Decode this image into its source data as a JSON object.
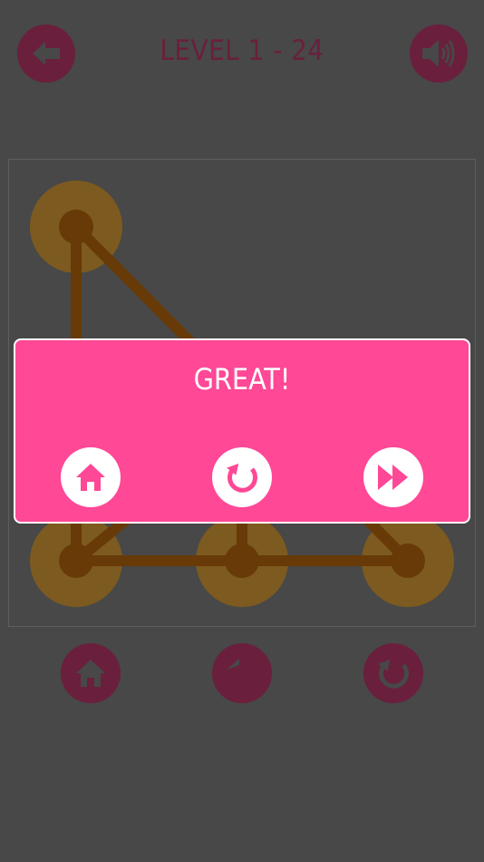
{
  "header": {
    "level_title": "LEVEL 1 - 24",
    "back_icon": "arrow-left-icon",
    "sound_icon": "speaker-volume-icon"
  },
  "puzzle": {
    "node_color": "#683a07",
    "halo_color": "#7d5a20",
    "line_color": "#683a07",
    "nodes": [
      "top-left",
      "bottom-left",
      "bottom-center",
      "bottom-right"
    ],
    "start_node": "top-left"
  },
  "dialog": {
    "message": "GREAT!",
    "buttons": [
      {
        "icon": "home-icon",
        "action": "home"
      },
      {
        "icon": "restart-icon",
        "action": "replay"
      },
      {
        "icon": "fast-forward-icon",
        "action": "next-level"
      }
    ],
    "background": "#ff4896"
  },
  "toolbar": {
    "buttons": [
      {
        "icon": "home-icon",
        "action": "home"
      },
      {
        "icon": "undo-icon",
        "action": "undo"
      },
      {
        "icon": "restart-icon",
        "action": "restart"
      }
    ]
  },
  "colors": {
    "background": "#474847",
    "button_dark": "#6a1f3d",
    "title_text": "#6a1f3d"
  }
}
